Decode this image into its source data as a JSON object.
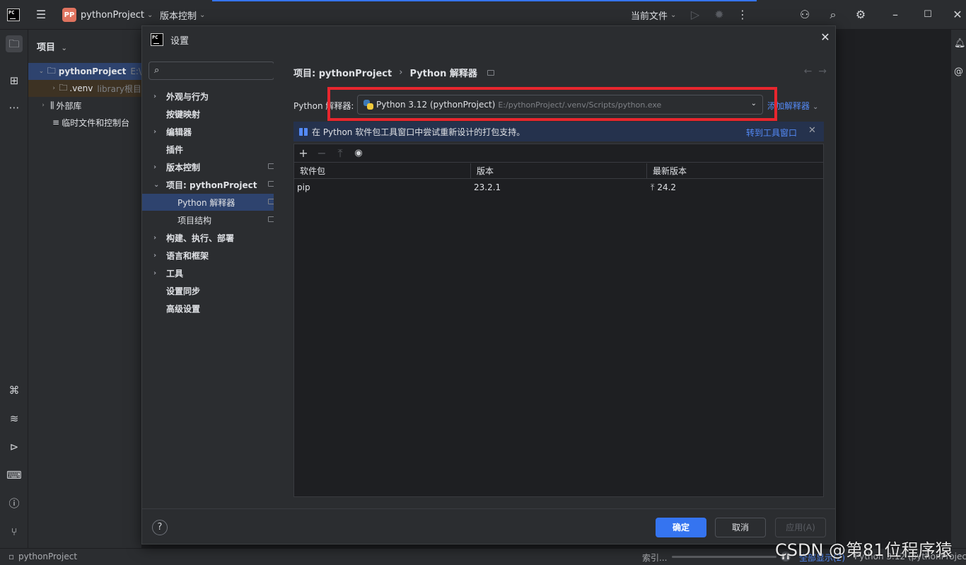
{
  "titlebar": {
    "project_badge": "PP",
    "project_name": "pythonProject",
    "vcs_label": "版本控制",
    "run_config": "当前文件"
  },
  "left_panel": {
    "title": "项目",
    "tree": [
      {
        "label": "pythonProject",
        "suffix": "E:\\"
      },
      {
        "label": ".venv",
        "suffix": "library根目"
      },
      {
        "label": "外部库",
        "suffix": ""
      },
      {
        "label": "临时文件和控制台",
        "suffix": ""
      }
    ]
  },
  "dialog": {
    "title": "设置",
    "search": {
      "placeholder": "",
      "value": ""
    },
    "nav": [
      {
        "label": "外观与行为"
      },
      {
        "label": "按键映射"
      },
      {
        "label": "编辑器"
      },
      {
        "label": "插件"
      },
      {
        "label": "版本控制"
      },
      {
        "label": "项目: pythonProject"
      },
      {
        "label": "Python 解释器"
      },
      {
        "label": "项目结构"
      },
      {
        "label": "构建、执行、部署"
      },
      {
        "label": "语言和框架"
      },
      {
        "label": "工具"
      },
      {
        "label": "设置同步"
      },
      {
        "label": "高级设置"
      }
    ],
    "breadcrumb": {
      "root": "项目: pythonProject",
      "leaf": "Python 解释器"
    },
    "interpreter": {
      "label": "Python 解释器:",
      "name": "Python 3.12 (pythonProject)",
      "path": "E:/pythonProject/.venv/Scripts/python.exe",
      "add_label": "添加解释器"
    },
    "banner": {
      "text": "在 Python 软件包工具窗口中尝试重新设计的打包支持。",
      "link": "转到工具窗口"
    },
    "packages": {
      "columns": [
        "软件包",
        "版本",
        "最新版本"
      ],
      "rows": [
        {
          "name": "pip",
          "version": "23.2.1",
          "latest": "24.2"
        }
      ]
    },
    "footer": {
      "help": "?",
      "ok": "确定",
      "cancel": "取消",
      "apply": "应用(A)"
    }
  },
  "statusbar": {
    "project": "pythonProject",
    "indexing": "索引...",
    "show_all": "全部显示(2)",
    "interpreter": "Python 3.12 (pythonProject)"
  },
  "watermark": "CSDN @第81位程序猿"
}
